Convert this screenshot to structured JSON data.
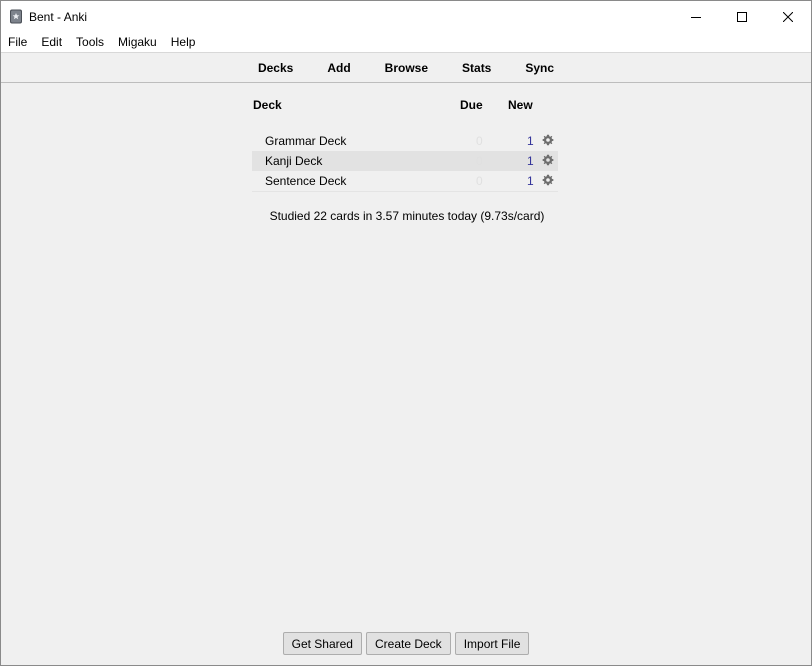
{
  "window": {
    "title": "Bent - Anki",
    "controls": {
      "minimize": "minimize-icon",
      "maximize": "maximize-icon",
      "close": "close-icon"
    }
  },
  "menubar": {
    "items": [
      "File",
      "Edit",
      "Tools",
      "Migaku",
      "Help"
    ]
  },
  "toolbar": {
    "items": [
      "Decks",
      "Add",
      "Browse",
      "Stats",
      "Sync"
    ]
  },
  "decks": {
    "headers": {
      "deck": "Deck",
      "due": "Due",
      "new": "New"
    },
    "rows": [
      {
        "name": "Grammar Deck",
        "due": "0",
        "new": "1"
      },
      {
        "name": "Kanji Deck",
        "due": "0",
        "new": "1"
      },
      {
        "name": "Sentence Deck",
        "due": "0",
        "new": "1"
      }
    ]
  },
  "stats": {
    "studied": "Studied 22 cards in 3.57 minutes today (9.73s/card)"
  },
  "bottom": {
    "get_shared": "Get Shared",
    "create_deck": "Create Deck",
    "import_file": "Import File"
  },
  "colors": {
    "new_count": "#33339a",
    "due_zero": "#e0e0e0",
    "row_highlight": "#e2e2e2"
  }
}
